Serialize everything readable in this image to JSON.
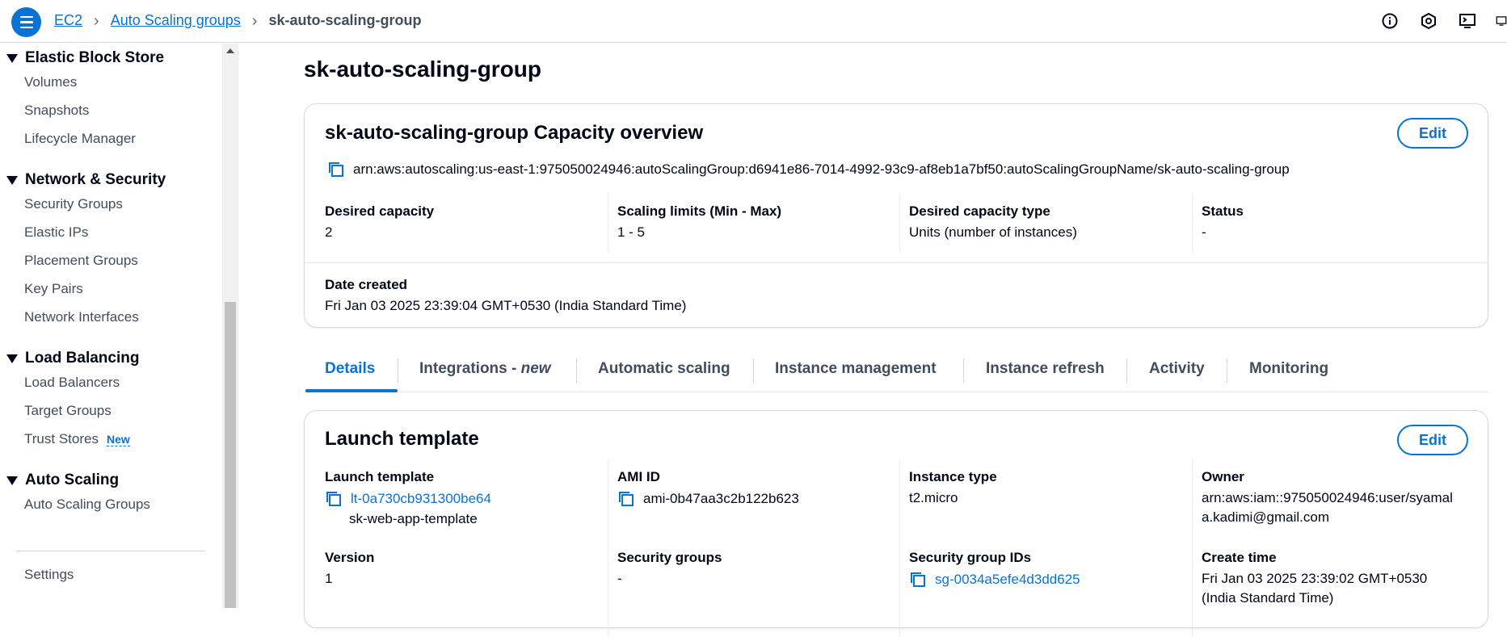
{
  "breadcrumb": {
    "items": [
      "EC2",
      "Auto Scaling groups"
    ],
    "current": "sk-auto-scaling-group"
  },
  "top_icons": [
    "info-icon",
    "settings-hex-icon",
    "cloudshell-icon",
    "feedback-icon"
  ],
  "sidebar": {
    "sections": [
      {
        "title": "Elastic Block Store",
        "items": [
          "Volumes",
          "Snapshots",
          "Lifecycle Manager"
        ]
      },
      {
        "title": "Network & Security",
        "items": [
          "Security Groups",
          "Elastic IPs",
          "Placement Groups",
          "Key Pairs",
          "Network Interfaces"
        ]
      },
      {
        "title": "Load Balancing",
        "items": [
          "Load Balancers",
          "Target Groups",
          "Trust Stores"
        ]
      },
      {
        "title": "Auto Scaling",
        "items": [
          "Auto Scaling Groups"
        ]
      }
    ],
    "new_badge": "New",
    "settings": "Settings"
  },
  "page": {
    "title": "sk-auto-scaling-group"
  },
  "capacity": {
    "title": "sk-auto-scaling-group Capacity overview",
    "edit": "Edit",
    "arn": "arn:aws:autoscaling:us-east-1:975050024946:autoScalingGroup:d6941e86-7014-4992-93c9-af8eb1a7bf50:autoScalingGroupName/sk-auto-scaling-group",
    "desired_capacity_label": "Desired capacity",
    "desired_capacity": "2",
    "scaling_limits_label": "Scaling limits (Min - Max)",
    "scaling_limits": "1 - 5",
    "capacity_type_label": "Desired capacity type",
    "capacity_type": "Units (number of instances)",
    "status_label": "Status",
    "status": "-",
    "date_created_label": "Date created",
    "date_created": "Fri Jan 03 2025 23:39:04 GMT+0530 (India Standard Time)"
  },
  "tabs": {
    "details": "Details",
    "integrations": "Integrations - ",
    "integrations_new": "new",
    "automatic_scaling": "Automatic scaling",
    "instance_management": "Instance management",
    "instance_refresh": "Instance refresh",
    "activity": "Activity",
    "monitoring": "Monitoring"
  },
  "launch": {
    "title": "Launch template",
    "edit": "Edit",
    "lt_label": "Launch template",
    "lt_id": "lt-0a730cb931300be64",
    "lt_name": "sk-web-app-template",
    "ami_label": "AMI ID",
    "ami_id": "ami-0b47aa3c2b122b623",
    "instance_type_label": "Instance type",
    "instance_type": "t2.micro",
    "owner_label": "Owner",
    "owner_line1": "arn:aws:iam::975050024946:user/syamal",
    "owner_line2": "a.kadimi@gmail.com",
    "version_label": "Version",
    "version": "1",
    "sg_label": "Security groups",
    "sg": "-",
    "sg_ids_label": "Security group IDs",
    "sg_id": "sg-0034a5efe4d3dd625",
    "create_time_label": "Create time",
    "create_time_line1": "Fri Jan 03 2025 23:39:02 GMT+0530",
    "create_time_line2": "(India Standard Time)"
  },
  "colors": {
    "accent": "#0972d3",
    "text": "#000716",
    "muted": "#414d5c"
  }
}
